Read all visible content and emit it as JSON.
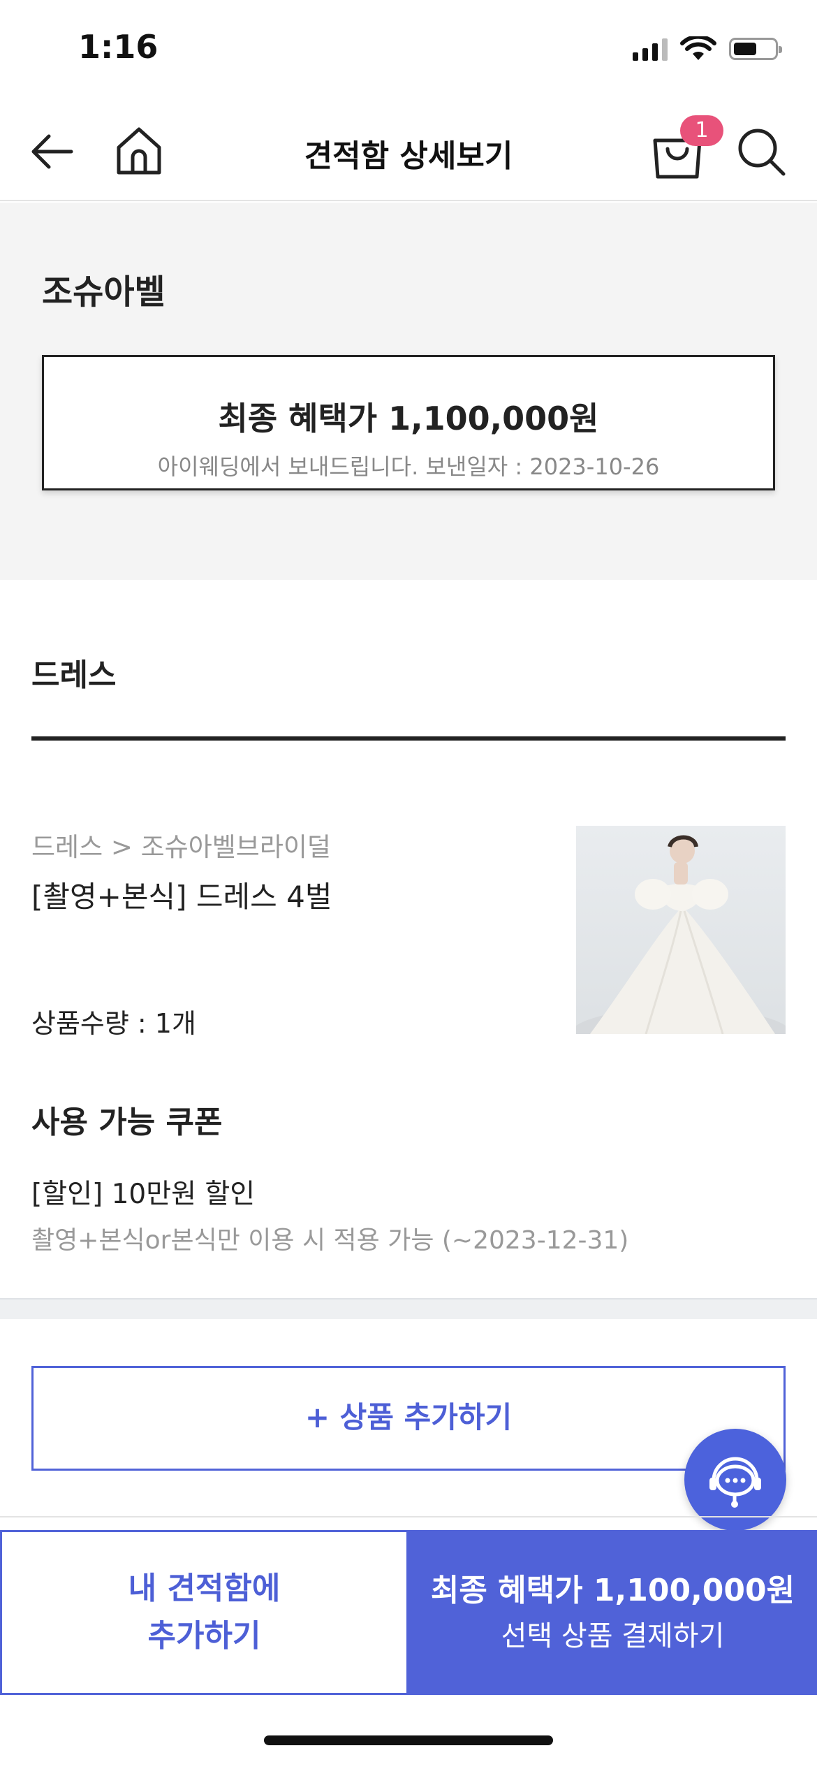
{
  "status_bar": {
    "time": "1:16"
  },
  "header": {
    "title": "견적함 상세보기",
    "cart_badge": "1",
    "icons": [
      "back-arrow-icon",
      "home-icon",
      "cart-icon",
      "search-icon"
    ]
  },
  "summary": {
    "shop_name": "조슈아벨",
    "final_price": "최종 혜택가 1,100,000원",
    "sent_info": "아이웨딩에서 보내드립니다. 보낸일자 : 2023-10-26"
  },
  "section": {
    "title": "드레스"
  },
  "product": {
    "breadcrumb": "드레스 > 조슈아벨브라이덜",
    "name": "[촬영+본식] 드레스 4벌",
    "quantity": "상품수량 : 1개"
  },
  "coupon": {
    "heading": "사용 가능 쿠폰",
    "name": "[할인] 10만원 할인",
    "description": "촬영+본식or본식만 이용 시 적용 가능 (~2023-12-31)"
  },
  "add_product_label": "+ 상품 추가하기",
  "bottom_bar": {
    "left_line1": "내 견적함에",
    "left_line2": "추가하기",
    "right_line1": "최종 혜택가 1,100,000원",
    "right_line2": "선택 상품 결제하기"
  },
  "colors": {
    "accent": "#5062d8",
    "badge": "#e8527a"
  }
}
